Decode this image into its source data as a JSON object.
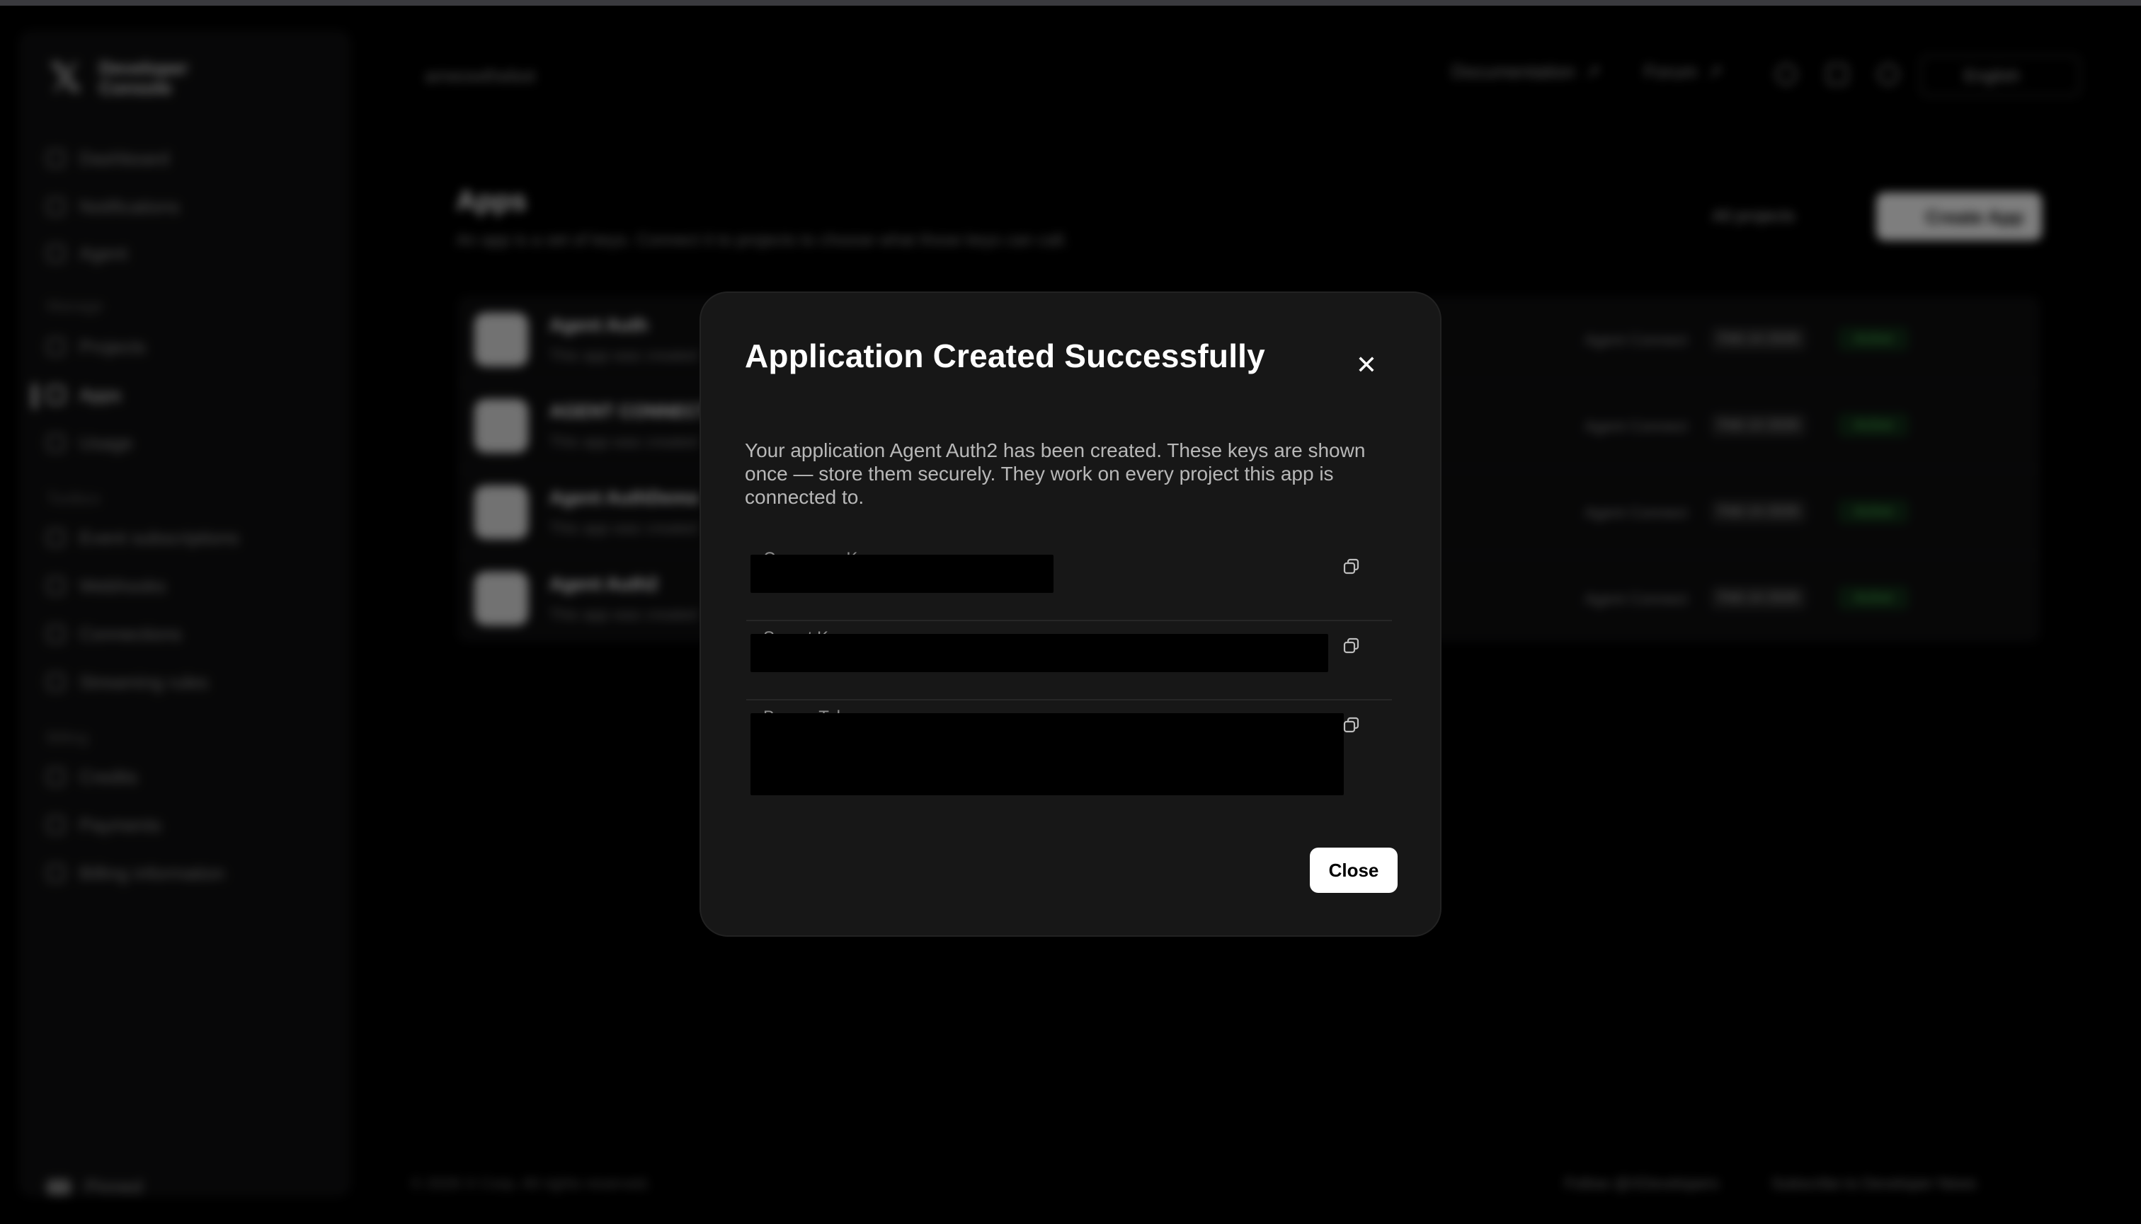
{
  "background": {
    "sidebar": {
      "logo_text": "Developer Console",
      "items_top": [
        "Dashboard",
        "Notifications",
        "Agent"
      ],
      "section_manage": "Manage",
      "items_manage": [
        "Projects",
        "Apps",
        "Usage"
      ],
      "section_tools": "Toolbox",
      "items_tools": [
        "Event subscriptions",
        "Webhooks",
        "Connections",
        "Streaming rules"
      ],
      "section_billing": "Billing",
      "items_billing": [
        "Credits",
        "Payments",
        "Billing information"
      ],
      "footer_label": "Pinned"
    },
    "header": {
      "breadcrumb": "ameowthebot",
      "documentation": "Documentation",
      "forum": "Forum",
      "language": "English"
    },
    "page": {
      "title": "Apps",
      "subtitle": "An app is a set of keys. Connect it to projects to choose what those keys can call.",
      "project_filter": "All projects",
      "create_button": "Create App"
    },
    "apps": [
      {
        "name": "Agent Auth",
        "desc": "This app was created",
        "meta": "Agent Connect",
        "date": "Feb 14 2026",
        "status": "Active"
      },
      {
        "name": "AGENT CONNECT",
        "desc": "This app was created",
        "meta": "Agent Connect",
        "date": "Feb 14 2026",
        "status": "Active"
      },
      {
        "name": "Agent AuthDemo",
        "desc": "This app was created",
        "meta": "Agent Connect",
        "date": "Feb 14 2026",
        "status": "Active"
      },
      {
        "name": "Agent Auth2",
        "desc": "This app was created",
        "meta": "Agent Connect",
        "date": "Feb 14 2026",
        "status": "Active"
      }
    ],
    "footer": {
      "copyright": "© 2026 X Corp. All rights reserved.",
      "follow": "Follow @XDevelopers",
      "subscribe": "Subscribe to Developer News"
    }
  },
  "modal": {
    "title": "Application Created Successfully",
    "close_icon": "close-icon",
    "description": "Your application Agent Auth2 has been created. These keys are shown once — store them securely. They work on every project this app is connected to.",
    "keys": [
      {
        "label": "Consumer Key",
        "value": ""
      },
      {
        "label": "Secret Key",
        "value": ""
      },
      {
        "label": "Bearer Token",
        "value": ""
      }
    ],
    "close_button": "Close"
  }
}
